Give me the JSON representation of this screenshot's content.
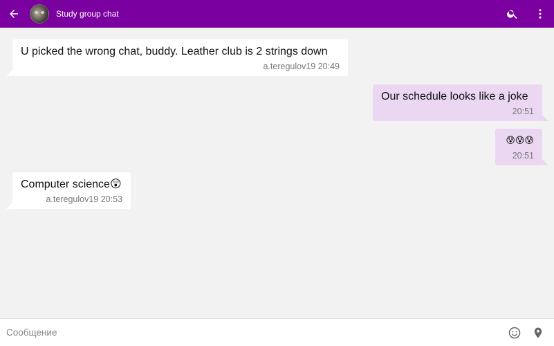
{
  "header": {
    "title": "Study group chat",
    "background": "#7b00a0",
    "back_icon": "arrow-left-icon",
    "search_icon": "search-icon",
    "menu_icon": "more-vertical-icon"
  },
  "messages": [
    {
      "direction": "incoming",
      "text": "U picked the wrong chat, buddy. Leather club is 2 strings down",
      "author_time": "a.teregulov19 20:49"
    },
    {
      "direction": "outgoing",
      "text": "Our schedule looks like a joke",
      "time": "20:51"
    },
    {
      "direction": "outgoing",
      "text": "😰😰😰",
      "time": "20:51"
    },
    {
      "direction": "incoming",
      "text": "Computer science😲",
      "author_time": "a.teregulov19 20:53"
    }
  ],
  "composer": {
    "placeholder": "Сообщение",
    "emoji_icon": "smile-icon",
    "location_icon": "location-pin-icon"
  },
  "colors": {
    "incoming_bubble": "#ffffff",
    "outgoing_bubble": "#ebd7f2",
    "chat_background": "#f2f2f2"
  }
}
